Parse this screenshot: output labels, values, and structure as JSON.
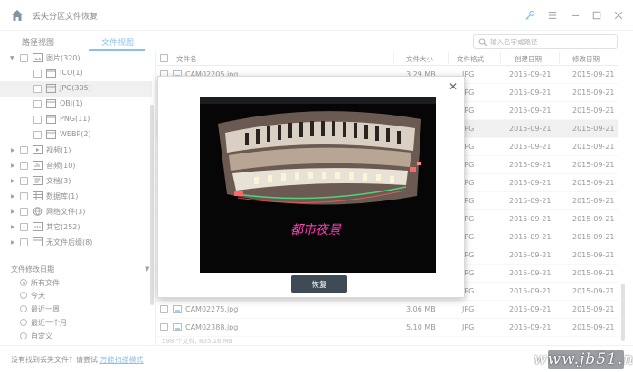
{
  "window": {
    "title": "丢失分区文件恢复",
    "icons": {
      "home": "home-icon",
      "key": "key-icon",
      "menu": "menu-icon",
      "minimize": "minimize-icon",
      "maximize": "maximize-icon",
      "close": "close-icon"
    },
    "accent_color": "#2a8fd6"
  },
  "view_tabs": [
    {
      "label": "路径视图",
      "active": false
    },
    {
      "label": "文件视图",
      "active": true
    }
  ],
  "search": {
    "placeholder": "输入名字或路径"
  },
  "tree": [
    {
      "label": "图片(320)",
      "expanded": true,
      "level": 0,
      "icon": "image-folder-icon"
    },
    {
      "label": "ICO(1)",
      "level": 1,
      "icon": "folder-icon"
    },
    {
      "label": "JPG(305)",
      "level": 1,
      "icon": "folder-icon",
      "selected": true
    },
    {
      "label": "OBJ(1)",
      "level": 1,
      "icon": "folder-icon"
    },
    {
      "label": "PNG(11)",
      "level": 1,
      "icon": "folder-icon"
    },
    {
      "label": "WEBP(2)",
      "level": 1,
      "icon": "folder-icon"
    },
    {
      "label": "视频(1)",
      "level": 0,
      "icon": "video-icon"
    },
    {
      "label": "音频(10)",
      "level": 0,
      "icon": "audio-icon"
    },
    {
      "label": "文档(3)",
      "level": 0,
      "icon": "document-icon"
    },
    {
      "label": "数据库(1)",
      "level": 0,
      "icon": "database-icon"
    },
    {
      "label": "网络文件(3)",
      "level": 0,
      "icon": "globe-icon"
    },
    {
      "label": "其它(252)",
      "level": 0,
      "icon": "other-icon"
    },
    {
      "label": "无文件后缀(8)",
      "level": 0,
      "icon": "no-extension-icon"
    }
  ],
  "filter": {
    "title": "文件修改日期",
    "options": [
      {
        "label": "所有文件",
        "checked": true
      },
      {
        "label": "今天",
        "checked": false
      },
      {
        "label": "最近一周",
        "checked": false
      },
      {
        "label": "最近一个月",
        "checked": false
      },
      {
        "label": "自定义",
        "checked": false
      }
    ]
  },
  "table": {
    "columns": [
      "文件名",
      "文件大小",
      "文件格式",
      "创建日期",
      "修改日期"
    ],
    "rows": [
      {
        "name": "CAM02205.jpg",
        "size": "3.29 MB",
        "format": "JPG",
        "created": "2015-09-21",
        "modified": "2015-09-21"
      },
      {
        "name": "",
        "size": "",
        "format": "JPG",
        "created": "2015-09-21",
        "modified": "2015-09-21"
      },
      {
        "name": "",
        "size": "",
        "format": "JPG",
        "created": "2015-09-21",
        "modified": "2015-09-21"
      },
      {
        "name": "",
        "size": "",
        "format": "JPG",
        "created": "2015-09-21",
        "modified": "2015-09-21",
        "selected": true
      },
      {
        "name": "",
        "size": "",
        "format": "JPG",
        "created": "2015-09-21",
        "modified": "2015-09-21"
      },
      {
        "name": "",
        "size": "",
        "format": "JPG",
        "created": "2015-09-21",
        "modified": "2015-09-21"
      },
      {
        "name": "",
        "size": "",
        "format": "JPG",
        "created": "2015-09-21",
        "modified": "2015-09-21"
      },
      {
        "name": "",
        "size": "",
        "format": "JPG",
        "created": "2015-09-21",
        "modified": "2015-09-21"
      },
      {
        "name": "",
        "size": "",
        "format": "JPG",
        "created": "2015-09-21",
        "modified": "2015-09-21"
      },
      {
        "name": "",
        "size": "",
        "format": "JPG",
        "created": "2015-09-21",
        "modified": "2015-09-21"
      },
      {
        "name": "",
        "size": "",
        "format": "JPG",
        "created": "2015-09-21",
        "modified": "2015-09-21"
      },
      {
        "name": "",
        "size": "",
        "format": "JPG",
        "created": "2015-09-21",
        "modified": "2015-09-21"
      },
      {
        "name": "",
        "size": "",
        "format": "JPG",
        "created": "2015-09-21",
        "modified": "2015-09-21"
      },
      {
        "name": "CAM02275.jpg",
        "size": "3.06 MB",
        "format": "JPG",
        "created": "2015-09-21",
        "modified": "2015-09-21"
      },
      {
        "name": "CAM02388.jpg",
        "size": "5.10 MB",
        "format": "JPG",
        "created": "2015-09-21",
        "modified": "2015-09-21"
      }
    ],
    "footer": "598 个文件, 835.16 MB"
  },
  "preview": {
    "restore_label": "恢复",
    "photo_caption": "都市夜景"
  },
  "bottom": {
    "hint": "没有找到丢失文件？请尝试",
    "link": "万能扫描模式",
    "watermark": "www.jb51.net"
  }
}
